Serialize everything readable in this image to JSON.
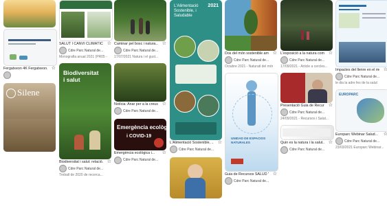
{
  "cards": {
    "c1a": {
      "title": "Fergatxeon 4K Fergatxeon..."
    },
    "c2a": {
      "title": "SALUT I CANVI CLIMÀTIC",
      "author": "Cdre Parc Natural de...",
      "date": "Monografia anual 2021 (PR05 -..."
    },
    "c2b": {
      "overlay": "Biodiversitat i salut",
      "title": "Biodiversitat i salut: relació...",
      "author": "Cdre Parc Natural de...",
      "date": "Treball de 2020 de recerca..."
    },
    "c1b": {
      "overlay": "Silene"
    },
    "c3a": {
      "title": "Caminar pel bosc i natura...",
      "author": "Cdre Parc Natural de...",
      "date": "17/07/2021 Natura i el gust..."
    },
    "c3b": {
      "title": "Notícia: Anar per a la creus...",
      "author": "Cdre Parc Natural de..."
    },
    "c3c": {
      "overlay": "Emergència ecològica",
      "overlay2": "i COVID-19",
      "title": "Emergència ecològica i...",
      "author": "Cdre Parc Natural de..."
    },
    "c4a": {
      "overlay": "L'Alimentació Sostenible, i Saludable",
      "year": "2021",
      "title": "L'Alimentació Sostenible, ...",
      "author": "Cdre Parc Natural de..."
    },
    "c5a": {
      "title": "Dos del món sostenible amb...",
      "author": "Cdre Parc Natural de...",
      "date": "Octubre 2021 - Naturatl del món..."
    },
    "c5b": {
      "overlay": "UNIDAD DE ESPACIOS NATURALES",
      "title": "Guia de Recursos SALUD Y...",
      "author": "Cdre Parc Natural de..."
    },
    "c6a": {
      "title": "L'exposició a la natura com...",
      "author": "Cdre Parc Natural de...",
      "date": "17/09/2021 - Article a cercles..."
    },
    "c6b": {
      "title": "Presentació Guia de Recursos...",
      "author": "Cdre Parc Natural de...",
      "date": "24/09/2021 - Recursos i Salut..."
    },
    "c6c": {
      "title": "Quin es la natura i la salut...",
      "author": "Cdre Parc Natural de..."
    },
    "c7a": {
      "title": "Impactes del llenre en el me...",
      "author": "Cdre Parc Natural de...",
      "date": "le dia la adre fes de la salut"
    },
    "c7b": {
      "overlay": "EUROPARC",
      "title": "Europarc Webinar Salud...",
      "author": "Cdre Parc Natural de...",
      "date": "23/03/2021 Europarc Webinar..."
    }
  }
}
